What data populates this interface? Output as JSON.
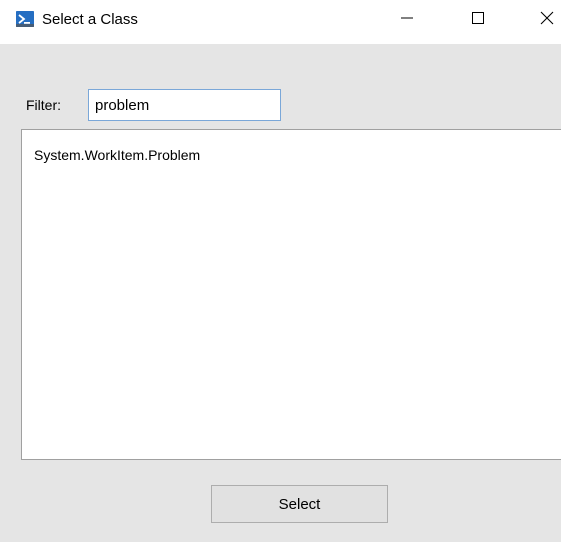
{
  "window": {
    "title": "Select a Class",
    "app_icon": "powershell-icon",
    "controls": {
      "minimize_icon": "minimize-icon",
      "maximize_icon": "maximize-icon",
      "close_icon": "close-icon"
    }
  },
  "filter": {
    "label": "Filter:",
    "value": "problem"
  },
  "class_list": {
    "items": [
      {
        "label": "System.WorkItem.Problem"
      }
    ]
  },
  "actions": {
    "select_label": "Select"
  },
  "colors": {
    "client_background": "#e5e5e5",
    "input_border": "#7aa7d8",
    "button_background": "#e1e1e1",
    "icon_blue": "#2b6cb0"
  }
}
